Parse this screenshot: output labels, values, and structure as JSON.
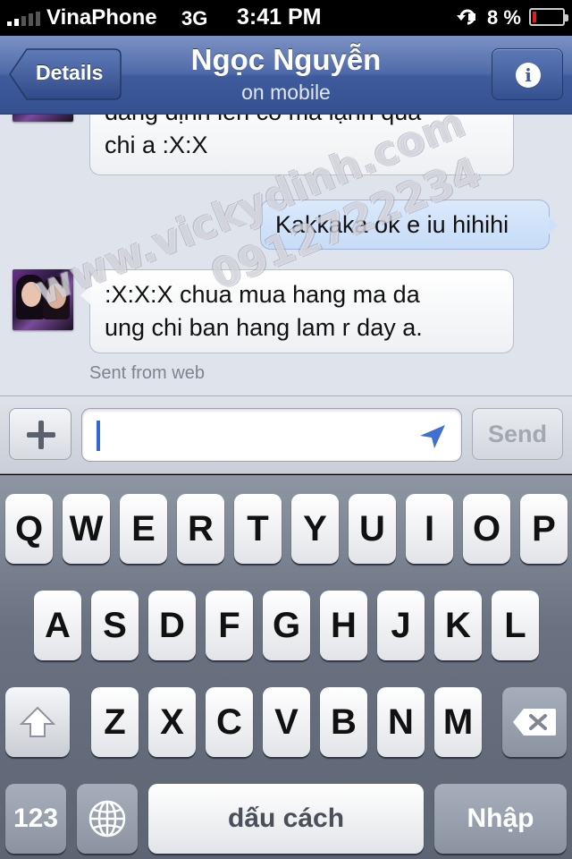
{
  "status_bar": {
    "carrier": "VinaPhone",
    "network": "3G",
    "time": "3:41 PM",
    "battery_percent": "8 %",
    "battery_level": 0.08,
    "signal_bars": 2,
    "battery_color": "#e02020"
  },
  "nav_bar": {
    "back_label": "Details",
    "title": "Ngọc Nguyễn",
    "subtitle": "on mobile",
    "info_glyph": "i",
    "colors": {
      "bar": "#4f6aa9"
    }
  },
  "conversation": {
    "messages": [
      {
        "direction": "incoming",
        "lines": [
          "đang định lên có mà lạnh quá",
          "chi a :X:X"
        ],
        "avatar": "contact-photo"
      },
      {
        "direction": "outgoing",
        "lines": [
          "Kakkaka ok e iu hihihi"
        ]
      },
      {
        "direction": "incoming",
        "lines": [
          ":X:X:X chua mua hang ma da",
          "ung chi ban hang lam r day a."
        ],
        "avatar": "contact-photo"
      }
    ],
    "sent_from": "Sent from web"
  },
  "watermark": {
    "line1": "www.vickydinh.com",
    "line2": "0912722234"
  },
  "compose": {
    "add_icon": "plus-icon",
    "value": "",
    "location_icon": "location-arrow-icon",
    "send_label": "Send"
  },
  "keyboard": {
    "row1": [
      "Q",
      "W",
      "E",
      "R",
      "T",
      "Y",
      "U",
      "I",
      "O",
      "P"
    ],
    "row2": [
      "A",
      "S",
      "D",
      "F",
      "G",
      "H",
      "J",
      "K",
      "L"
    ],
    "row3": [
      "Z",
      "X",
      "C",
      "V",
      "B",
      "N",
      "M"
    ],
    "numbers_label": "123",
    "globe_icon": "globe-icon",
    "space_label": "dấu cách",
    "return_label": "Nhập",
    "shift_icon": "shift-icon",
    "delete_icon": "backspace-icon"
  }
}
